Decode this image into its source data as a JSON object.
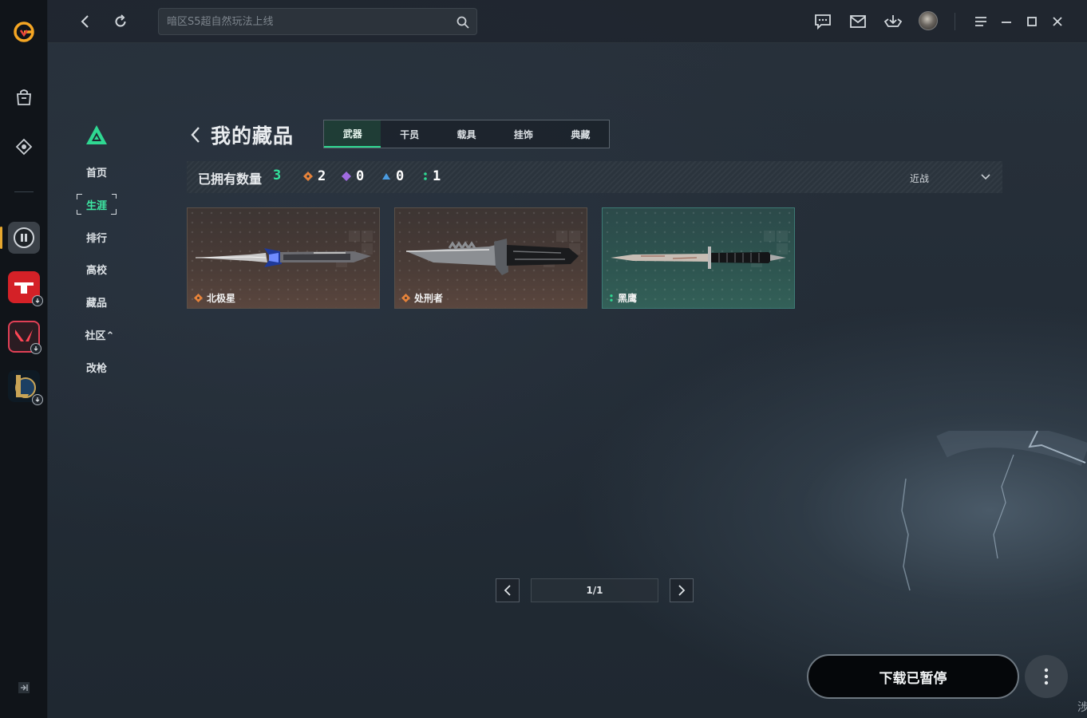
{
  "search": {
    "placeholder": "暗区S5超自然玩法上线"
  },
  "sidebar_nav": [
    {
      "label": "首页",
      "active": false
    },
    {
      "label": "生涯",
      "active": true
    },
    {
      "label": "排行",
      "active": false
    },
    {
      "label": "高校",
      "active": false
    },
    {
      "label": "藏品",
      "active": false
    },
    {
      "label": "社区⌃",
      "active": false
    },
    {
      "label": "改枪",
      "active": false
    }
  ],
  "header": {
    "title": "我的藏品",
    "tabs": [
      {
        "label": "武器",
        "active": true
      },
      {
        "label": "干员",
        "active": false
      },
      {
        "label": "载具",
        "active": false
      },
      {
        "label": "挂饰",
        "active": false
      },
      {
        "label": "典藏",
        "active": false
      }
    ]
  },
  "stats": {
    "label": "已拥有数量",
    "total": "3",
    "rarities": [
      {
        "icon": "orange-diamond-icon",
        "color": "#e7833a",
        "count": "2"
      },
      {
        "icon": "purple-diamond-icon",
        "color": "#a06be0",
        "count": "0"
      },
      {
        "icon": "blue-triangle-icon",
        "color": "#4a9be0",
        "count": "0"
      },
      {
        "icon": "green-dots-icon",
        "color": "#2fd892",
        "count": "1"
      }
    ],
    "filter": {
      "value": "近战"
    }
  },
  "cards": [
    {
      "name": "北极星",
      "rarity_icon": "orange-diamond-icon",
      "rarity_color": "#e7833a",
      "style": "bronze"
    },
    {
      "name": "处刑者",
      "rarity_icon": "orange-diamond-icon",
      "rarity_color": "#e7833a",
      "style": "bronze"
    },
    {
      "name": "黑鹰",
      "rarity_icon": "green-dots-icon",
      "rarity_color": "#2fd892",
      "style": "teal"
    }
  ],
  "pagination": {
    "indicator": "1/1"
  },
  "download": {
    "label": "下载已暂停"
  },
  "corner_glyph": "涉",
  "colors": {
    "accent_green": "#2fd892",
    "rail_active": "#e6a72f"
  }
}
